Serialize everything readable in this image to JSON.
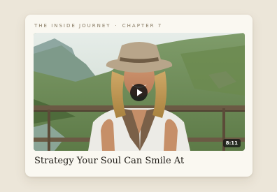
{
  "card": {
    "kicker": {
      "series": "THE INSIDE JOURNEY",
      "separator": "·",
      "chapter": "CHAPTER 7"
    },
    "video": {
      "duration": "8:11",
      "play_icon": "play-icon"
    },
    "title": "Strategy Your Soul Can Smile At"
  },
  "colors": {
    "page_background": "#ece6d9",
    "card_background": "#faf8f1",
    "kicker_text": "#8a7d66",
    "title_text": "#1e1b16",
    "overlay": "#141414"
  }
}
